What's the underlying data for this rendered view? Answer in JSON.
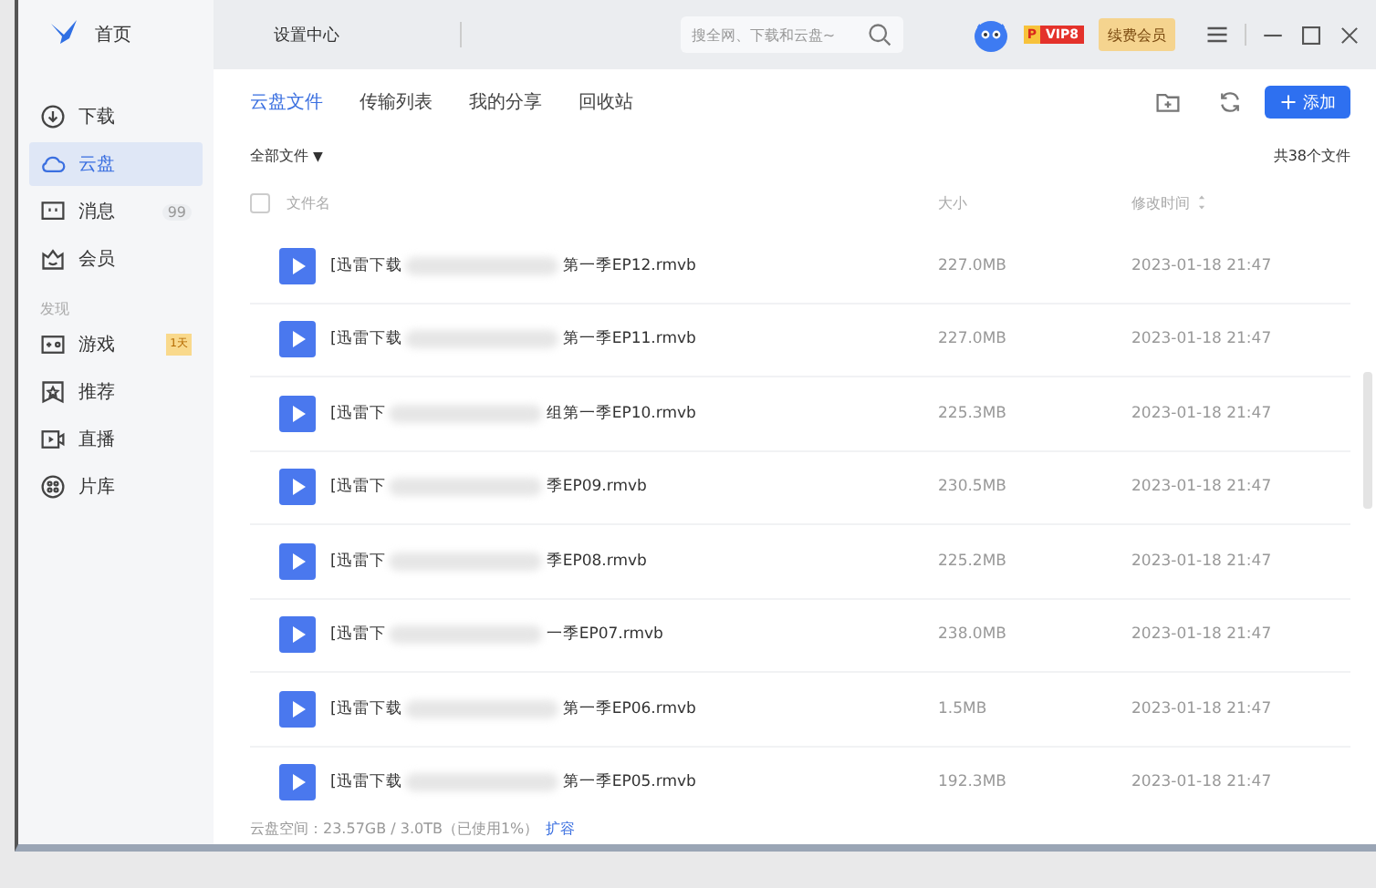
{
  "sidebar": {
    "home": {
      "label": "首页"
    },
    "items": [
      {
        "label": "下载",
        "kind": "download",
        "selected": false
      },
      {
        "label": "云盘",
        "kind": "cloud",
        "selected": true
      },
      {
        "label": "消息",
        "kind": "message",
        "selected": false,
        "badge": "99"
      },
      {
        "label": "会员",
        "kind": "member",
        "selected": false
      }
    ],
    "section": {
      "title": "发现",
      "items": [
        {
          "label": "游戏",
          "kind": "game",
          "selected": false,
          "tag": "1天"
        },
        {
          "label": "推荐",
          "kind": "recommend",
          "selected": false
        },
        {
          "label": "直播",
          "kind": "live",
          "selected": false
        },
        {
          "label": "片库",
          "kind": "library",
          "selected": false
        }
      ]
    }
  },
  "topbar": {
    "tabs": [
      {
        "label": "设置中心"
      }
    ],
    "search": {
      "placeholder": "搜全网、下载和云盘~"
    },
    "vip_badge": {
      "prefix": "P",
      "level": "VIP8"
    },
    "renew_button": "续费会员"
  },
  "tabs": [
    {
      "label": "云盘文件",
      "selected": true
    },
    {
      "label": "传输列表",
      "selected": false
    },
    {
      "label": "我的分享",
      "selected": false
    },
    {
      "label": "回收站",
      "selected": false
    }
  ],
  "add_button": "添加",
  "breadcrumb": {
    "label": "全部文件",
    "caret": "▼"
  },
  "file_count": "共38个文件",
  "table": {
    "select_all": {
      "checked": false
    },
    "columns": [
      "文件名",
      "大小",
      "修改时间"
    ],
    "rows": [
      {
        "name_start": "[迅雷下载",
        "name_end": "第一季EP12.rmvb",
        "size": "227.0MB",
        "modified": "2023-01-18 21:47"
      },
      {
        "name_start": "[迅雷下载",
        "name_end": "第一季EP11.rmvb",
        "size": "227.0MB",
        "modified": "2023-01-18 21:47"
      },
      {
        "name_start": "[迅雷下",
        "name_end": "组第一季EP10.rmvb",
        "size": "225.3MB",
        "modified": "2023-01-18 21:47"
      },
      {
        "name_start": "[迅雷下",
        "name_end": "季EP09.rmvb",
        "size": "230.5MB",
        "modified": "2023-01-18 21:47"
      },
      {
        "name_start": "[迅雷下",
        "name_end": "季EP08.rmvb",
        "size": "225.2MB",
        "modified": "2023-01-18 21:47"
      },
      {
        "name_start": "[迅雷下",
        "name_end": "一季EP07.rmvb",
        "size": "238.0MB",
        "modified": "2023-01-18 21:47"
      },
      {
        "name_start": "[迅雷下载",
        "name_end": "第一季EP06.rmvb",
        "size": "1.5MB",
        "modified": "2023-01-18 21:47"
      },
      {
        "name_start": "[迅雷下载",
        "name_end": "第一季EP05.rmvb",
        "size": "192.3MB",
        "modified": "2023-01-18 21:47"
      }
    ]
  },
  "footer": {
    "usage": "云盘空间：23.57GB / 3.0TB（已使用1%）",
    "link": "扩容"
  }
}
